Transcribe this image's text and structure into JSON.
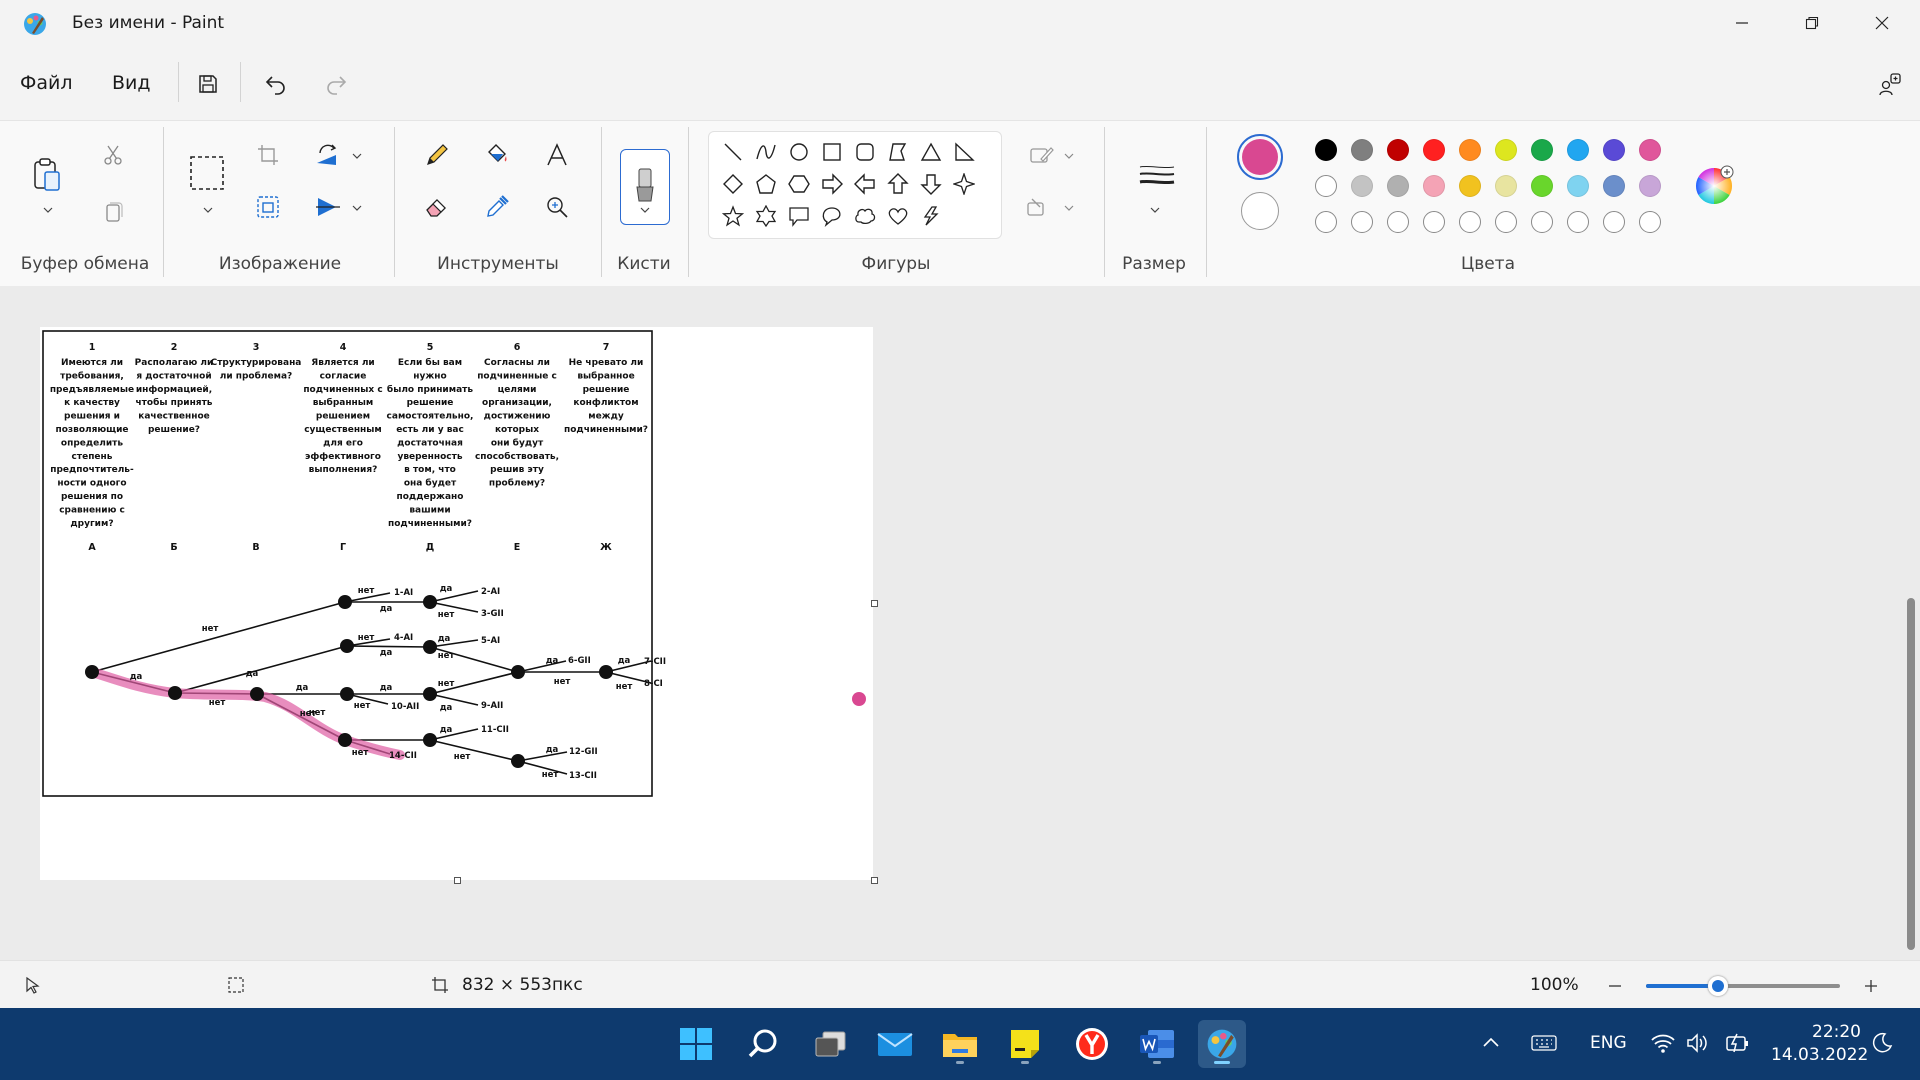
{
  "window": {
    "title": "Без имени - Paint"
  },
  "menu": {
    "file": "Файл",
    "view": "Вид"
  },
  "ribbon": {
    "groups": {
      "clipboard": "Буфер обмена",
      "image": "Изображение",
      "tools": "Инструменты",
      "brushes": "Кисти",
      "shapes": "Фигуры",
      "size": "Размер",
      "colors": "Цвета"
    },
    "primary_color": "#d94891",
    "secondary_color": "#ffffff",
    "palette": [
      [
        "#000000",
        "#7f7f7f",
        "#c00000",
        "#ff2020",
        "#ff8a1f",
        "#dde61f",
        "#1aa84a",
        "#21a6f0",
        "#5a4ad6",
        "#e0569b"
      ],
      [
        "#ffffff",
        "#c3c3c3",
        "#b0b0b0",
        "#f4a3b5",
        "#f1c21f",
        "#e8e4a0",
        "#69d62c",
        "#7fd3f0",
        "#6b8fcb",
        "#c8a6d8"
      ],
      [
        "#ffffff",
        "#ffffff",
        "#ffffff",
        "#ffffff",
        "#ffffff",
        "#ffffff",
        "#ffffff",
        "#ffffff",
        "#ffffff",
        "#ffffff"
      ]
    ]
  },
  "document": {
    "columns": [
      {
        "num": "1",
        "question": [
          "Имеются ли",
          "требования,",
          "предъявляемые",
          "к качеству",
          "решения и",
          "позволяющие",
          "определить",
          "степень",
          "предпочтитель-",
          "ности одного",
          "решения по",
          "сравнению с",
          "другим?"
        ],
        "letter": "А"
      },
      {
        "num": "2",
        "question": [
          "Располагаю ли",
          "я достаточной",
          "информацией,",
          "чтобы принять",
          "качественное",
          "решение?"
        ],
        "letter": "Б"
      },
      {
        "num": "3",
        "question": [
          "Структурирована",
          "ли проблема?"
        ],
        "letter": "В"
      },
      {
        "num": "4",
        "question": [
          "Является ли",
          "согласие",
          "подчиненных с",
          "выбранным",
          "решением",
          "существенным",
          "для его",
          "эффективного",
          "выполнения?"
        ],
        "letter": "Г"
      },
      {
        "num": "5",
        "question": [
          "Если бы вам",
          "нужно",
          "было принимать",
          "решение",
          "самостоятельно,",
          "есть ли у вас",
          "достаточная",
          "уверенность",
          "в том, что",
          "она будет",
          "поддержано",
          "вашими",
          "подчиненными?"
        ],
        "letter": "Д"
      },
      {
        "num": "6",
        "question": [
          "Согласны ли",
          "подчиненные с",
          "целями",
          "организации,",
          "достижению",
          "которых",
          "они будут",
          "способствовать,",
          "решив эту",
          "проблему?"
        ],
        "letter": "Е"
      },
      {
        "num": "7",
        "question": [
          "Не чревато ли",
          "выбранное",
          "решение",
          "конфликтом",
          "между",
          "подчиненными?"
        ],
        "letter": "Ж"
      }
    ],
    "labels": {
      "yes": "да",
      "no": "нет",
      "outcomes": [
        "1-AI",
        "2-AI",
        "3-GII",
        "4-AI",
        "5-AI",
        "6-GII",
        "7-CII",
        "8-CI",
        "9-AII",
        "10-AII",
        "11-CII",
        "12-GII",
        "13-CII",
        "14-CII"
      ]
    }
  },
  "status": {
    "size": "832 × 553пкс",
    "zoom": "100%",
    "zoom_fraction": 0.37
  },
  "taskbar": {
    "lang": "ENG",
    "time": "22:20",
    "date": "14.03.2022"
  }
}
